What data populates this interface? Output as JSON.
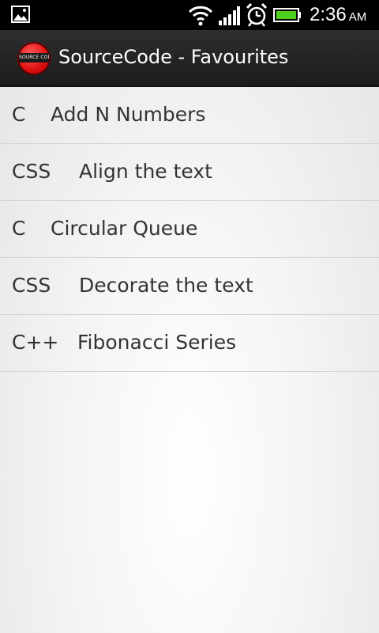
{
  "status_bar": {
    "time": "2:36",
    "ampm": "AM",
    "icons": [
      "gallery-icon",
      "wifi-icon",
      "signal-icon",
      "alarm-icon",
      "battery-icon"
    ],
    "battery_color": "#4cd01c"
  },
  "action_bar": {
    "logo_text": "SOURCE CODE",
    "title": "SourceCode - Favourites",
    "logo_color": "#e01010"
  },
  "favourites": [
    {
      "lang": "C",
      "name": "Add N Numbers"
    },
    {
      "lang": "CSS",
      "name": "Align the text"
    },
    {
      "lang": "C",
      "name": "Circular Queue"
    },
    {
      "lang": "CSS",
      "name": "Decorate the text"
    },
    {
      "lang": "C++",
      "name": "Fibonacci Series"
    }
  ]
}
